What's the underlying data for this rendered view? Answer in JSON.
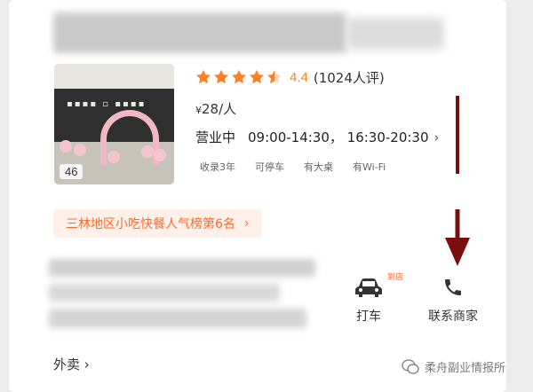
{
  "store": {
    "rating": {
      "value": 4.4,
      "text": "4.4",
      "stars": 4.5,
      "count_text": "(1024人评)"
    },
    "price": {
      "symbol": "¥",
      "amount": "28/人"
    },
    "hours": {
      "status": "营业中",
      "text": "09:00-14:30， 16:30-20:30"
    },
    "tags": [
      "收录3年",
      "可停车",
      "有大桌",
      "有Wi-Fi"
    ],
    "photo_count": "46",
    "rank_text": "三林地区小吃快餐人气榜第6名"
  },
  "actions": {
    "taxi": {
      "label": "打车",
      "badge": "到店",
      "icon": "car-icon"
    },
    "contact": {
      "label": "联系商家",
      "icon": "phone-icon"
    }
  },
  "takeout_label": "外卖",
  "watermark": "柔舟副业情报所",
  "colors": {
    "accent": "#ff7f27",
    "arrow": "#7a0d0d",
    "rank_bg": "#fff1ea"
  }
}
